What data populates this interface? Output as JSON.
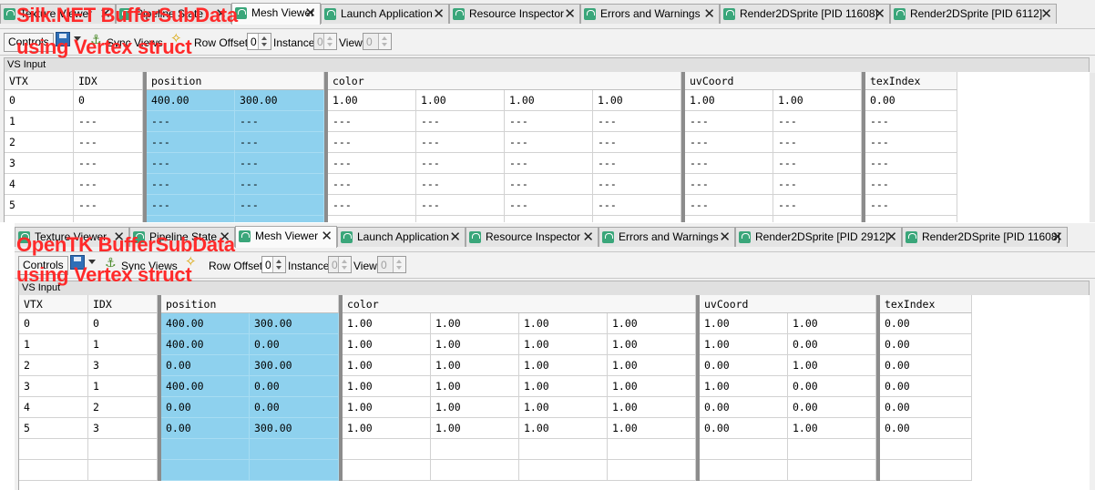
{
  "top": {
    "overlay": [
      "Silk.NET BufferSubData",
      "using Vertex struct"
    ],
    "tabs": [
      {
        "label": "Texture Viewer",
        "active": false
      },
      {
        "label": "Pipeline State",
        "active": false
      },
      {
        "label": "Mesh Viewer",
        "active": true
      },
      {
        "label": "Launch Application",
        "active": false
      },
      {
        "label": "Resource Inspector",
        "active": false
      },
      {
        "label": "Errors and Warnings",
        "active": false
      },
      {
        "label": "Render2DSprite [PID 11608]",
        "active": false
      },
      {
        "label": "Render2DSprite [PID 6112]",
        "active": false
      }
    ],
    "toolbar": {
      "controls": "Controls",
      "sync_views": "Sync Views",
      "row_offset_label": "Row Offset",
      "row_offset": "0",
      "instance_label": "Instance",
      "instance": "0",
      "view_label": "View",
      "view": "0"
    },
    "section": "VS Input",
    "headers": [
      "VTX",
      "IDX",
      "position",
      "color",
      "uvCoord",
      "texIndex"
    ],
    "rows": [
      [
        "0",
        "0",
        "400.00",
        "300.00",
        "1.00",
        "1.00",
        "1.00",
        "1.00",
        "1.00",
        "1.00",
        "0.00"
      ],
      [
        "1",
        "---",
        "---",
        "---",
        "---",
        "---",
        "---",
        "---",
        "---",
        "---",
        "---"
      ],
      [
        "2",
        "---",
        "---",
        "---",
        "---",
        "---",
        "---",
        "---",
        "---",
        "---",
        "---"
      ],
      [
        "3",
        "---",
        "---",
        "---",
        "---",
        "---",
        "---",
        "---",
        "---",
        "---",
        "---"
      ],
      [
        "4",
        "---",
        "---",
        "---",
        "---",
        "---",
        "---",
        "---",
        "---",
        "---",
        "---"
      ],
      [
        "5",
        "---",
        "---",
        "---",
        "---",
        "---",
        "---",
        "---",
        "---",
        "---",
        "---"
      ],
      [
        "",
        "---",
        "---",
        "---",
        "---",
        "---",
        "---",
        "---",
        "---",
        "---",
        "---"
      ]
    ]
  },
  "bottom": {
    "overlay": [
      "OpenTK BufferSubData",
      "using Vertex struct"
    ],
    "tabs": [
      {
        "label": "Texture Viewer",
        "active": false
      },
      {
        "label": "Pipeline State",
        "active": false
      },
      {
        "label": "Mesh Viewer",
        "active": true
      },
      {
        "label": "Launch Application",
        "active": false
      },
      {
        "label": "Resource Inspector",
        "active": false
      },
      {
        "label": "Errors and Warnings",
        "active": false
      },
      {
        "label": "Render2DSprite [PID 2912]",
        "active": false
      },
      {
        "label": "Render2DSprite [PID 11608]",
        "active": false
      }
    ],
    "toolbar": {
      "controls": "Controls",
      "sync_views": "Sync Views",
      "row_offset_label": "Row Offset",
      "row_offset": "0",
      "instance_label": "Instance",
      "instance": "0",
      "view_label": "View",
      "view": "0"
    },
    "section": "VS Input",
    "headers": [
      "VTX",
      "IDX",
      "position",
      "color",
      "uvCoord",
      "texIndex"
    ],
    "rows": [
      [
        "0",
        "0",
        "400.00",
        "300.00",
        "1.00",
        "1.00",
        "1.00",
        "1.00",
        "1.00",
        "1.00",
        "0.00"
      ],
      [
        "1",
        "1",
        "400.00",
        "0.00",
        "1.00",
        "1.00",
        "1.00",
        "1.00",
        "1.00",
        "0.00",
        "0.00"
      ],
      [
        "2",
        "3",
        "0.00",
        "300.00",
        "1.00",
        "1.00",
        "1.00",
        "1.00",
        "0.00",
        "1.00",
        "0.00"
      ],
      [
        "3",
        "1",
        "400.00",
        "0.00",
        "1.00",
        "1.00",
        "1.00",
        "1.00",
        "1.00",
        "0.00",
        "0.00"
      ],
      [
        "4",
        "2",
        "0.00",
        "0.00",
        "1.00",
        "1.00",
        "1.00",
        "1.00",
        "0.00",
        "0.00",
        "0.00"
      ],
      [
        "5",
        "3",
        "0.00",
        "300.00",
        "1.00",
        "1.00",
        "1.00",
        "1.00",
        "0.00",
        "1.00",
        "0.00"
      ],
      [
        "",
        "",
        "",
        "",
        "",
        "",
        "",
        "",
        "",
        "",
        ""
      ],
      [
        "",
        "",
        "",
        "",
        "",
        "",
        "",
        "",
        "",
        "",
        ""
      ]
    ]
  },
  "colors": {
    "position_highlight": "#8ed1ee",
    "overlay_text": "#ff2a2a",
    "tab_icon": "#3aa67a"
  }
}
